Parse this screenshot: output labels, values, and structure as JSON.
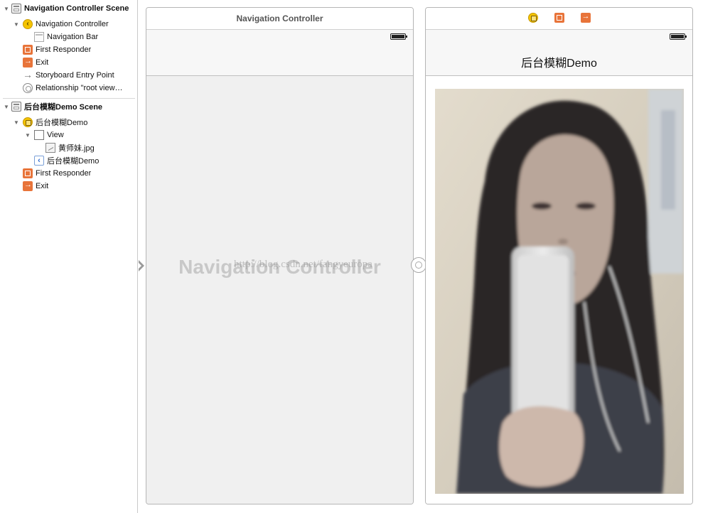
{
  "outline": {
    "scene1": {
      "title": "Navigation Controller Scene",
      "items": [
        {
          "label": "Navigation Controller"
        },
        {
          "label": "Navigation Bar"
        },
        {
          "label": "First Responder"
        },
        {
          "label": "Exit"
        },
        {
          "label": "Storyboard Entry Point"
        },
        {
          "label": "Relationship \"root view…"
        }
      ]
    },
    "scene2": {
      "title": "后台模糊Demo Scene",
      "items": [
        {
          "label": "后台模糊Demo"
        },
        {
          "label": "View"
        },
        {
          "label": "黄师妹.jpg"
        },
        {
          "label": "后台模糊Demo"
        },
        {
          "label": "First Responder"
        },
        {
          "label": "Exit"
        }
      ]
    }
  },
  "canvas": {
    "nav_scene": {
      "dock_title": "Navigation Controller",
      "placeholder": "Navigation Controller"
    },
    "demo_scene": {
      "nav_title": "后台模糊Demo"
    },
    "url_watermark": "http://blog.csdn.net/fangyeuropa"
  },
  "colors": {
    "accent_yellow": "#f5c400",
    "accent_orange": "#e8743a",
    "canvas_bg": "#f0f0f0"
  }
}
